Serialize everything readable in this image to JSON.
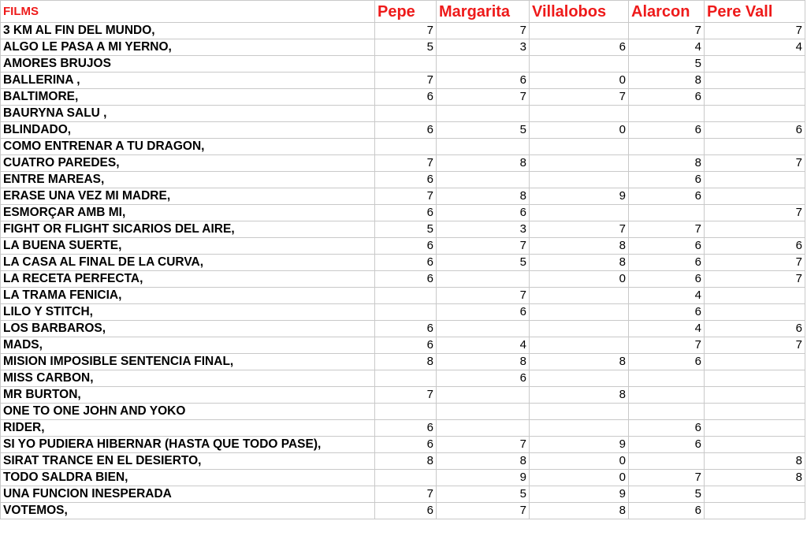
{
  "sheet": {
    "headers": [
      "FILMS",
      "Pepe",
      "Margarita",
      "Villalobos",
      "Alarcon",
      "Pere Vall"
    ],
    "rows": [
      {
        "title": "3 KM AL FIN DEL MUNDO,",
        "scores": [
          "7",
          "7",
          "",
          "7",
          "7"
        ]
      },
      {
        "title": "ALGO LE PASA A MI YERNO,",
        "scores": [
          "5",
          "3",
          "6",
          "4",
          "4"
        ]
      },
      {
        "title": "AMORES BRUJOS",
        "scores": [
          "",
          "",
          "",
          "5",
          ""
        ]
      },
      {
        "title": "BALLERINA ,",
        "scores": [
          "7",
          "6",
          "0",
          "8",
          ""
        ]
      },
      {
        "title": "BALTIMORE,",
        "scores": [
          "6",
          "7",
          "7",
          "6",
          ""
        ]
      },
      {
        "title": "BAURYNA SALU ,",
        "scores": [
          "",
          "",
          "",
          "",
          ""
        ]
      },
      {
        "title": "BLINDADO,",
        "scores": [
          "6",
          "5",
          "0",
          "6",
          "6"
        ]
      },
      {
        "title": "COMO ENTRENAR A TU DRAGON,",
        "scores": [
          "",
          "",
          "",
          "",
          ""
        ]
      },
      {
        "title": "CUATRO PAREDES,",
        "scores": [
          "7",
          "8",
          "",
          "8",
          "7"
        ]
      },
      {
        "title": "ENTRE MAREAS,",
        "scores": [
          "6",
          "",
          "",
          "6",
          ""
        ]
      },
      {
        "title": "ERASE UNA VEZ MI MADRE,",
        "scores": [
          "7",
          "8",
          "9",
          "6",
          ""
        ]
      },
      {
        "title": "ESMORÇAR AMB MI,",
        "scores": [
          "6",
          "6",
          "",
          "",
          "7"
        ]
      },
      {
        "title": "FIGHT OR FLIGHT SICARIOS DEL AIRE,",
        "scores": [
          "5",
          "3",
          "7",
          "7",
          ""
        ]
      },
      {
        "title": "LA BUENA SUERTE,",
        "scores": [
          "6",
          "7",
          "8",
          "6",
          "6"
        ]
      },
      {
        "title": "LA CASA AL FINAL DE LA CURVA,",
        "scores": [
          "6",
          "5",
          "8",
          "6",
          "7"
        ]
      },
      {
        "title": "LA RECETA PERFECTA,",
        "scores": [
          "6",
          "",
          "0",
          "6",
          "7"
        ]
      },
      {
        "title": "LA TRAMA FENICIA,",
        "scores": [
          "",
          "7",
          "",
          "4",
          ""
        ]
      },
      {
        "title": "LILO Y STITCH,",
        "scores": [
          "",
          "6",
          "",
          "6",
          ""
        ]
      },
      {
        "title": "LOS BARBAROS,",
        "scores": [
          "6",
          "",
          "",
          "4",
          "6"
        ]
      },
      {
        "title": "MADS,",
        "scores": [
          "6",
          "4",
          "",
          "7",
          "7"
        ]
      },
      {
        "title": "MISION IMPOSIBLE SENTENCIA FINAL,",
        "scores": [
          "8",
          "8",
          "8",
          "6",
          ""
        ]
      },
      {
        "title": "MISS CARBON,",
        "scores": [
          "",
          "6",
          "",
          "",
          ""
        ]
      },
      {
        "title": "MR BURTON,",
        "scores": [
          "7",
          "",
          "8",
          "",
          ""
        ]
      },
      {
        "title": "ONE TO ONE JOHN AND YOKO",
        "scores": [
          "",
          "",
          "",
          "",
          ""
        ]
      },
      {
        "title": "RIDER,",
        "scores": [
          "6",
          "",
          "",
          "6",
          ""
        ]
      },
      {
        "title": "SI YO PUDIERA HIBERNAR (HASTA QUE TODO PASE),",
        "scores": [
          "6",
          "7",
          "9",
          "6",
          ""
        ]
      },
      {
        "title": "SIRAT TRANCE EN EL DESIERTO,",
        "scores": [
          "8",
          "8",
          "0",
          "",
          "8"
        ]
      },
      {
        "title": "TODO SALDRA BIEN,",
        "scores": [
          "",
          "9",
          "0",
          "7",
          "8"
        ]
      },
      {
        "title": "UNA FUNCION INESPERADA",
        "scores": [
          "7",
          "5",
          "9",
          "5",
          ""
        ]
      },
      {
        "title": "VOTEMOS,",
        "scores": [
          "6",
          "7",
          "8",
          "6",
          ""
        ]
      }
    ]
  },
  "colors": {
    "header_text": "#ee1a1a",
    "grid": "#c9c9c9",
    "cell_text": "#000000"
  }
}
